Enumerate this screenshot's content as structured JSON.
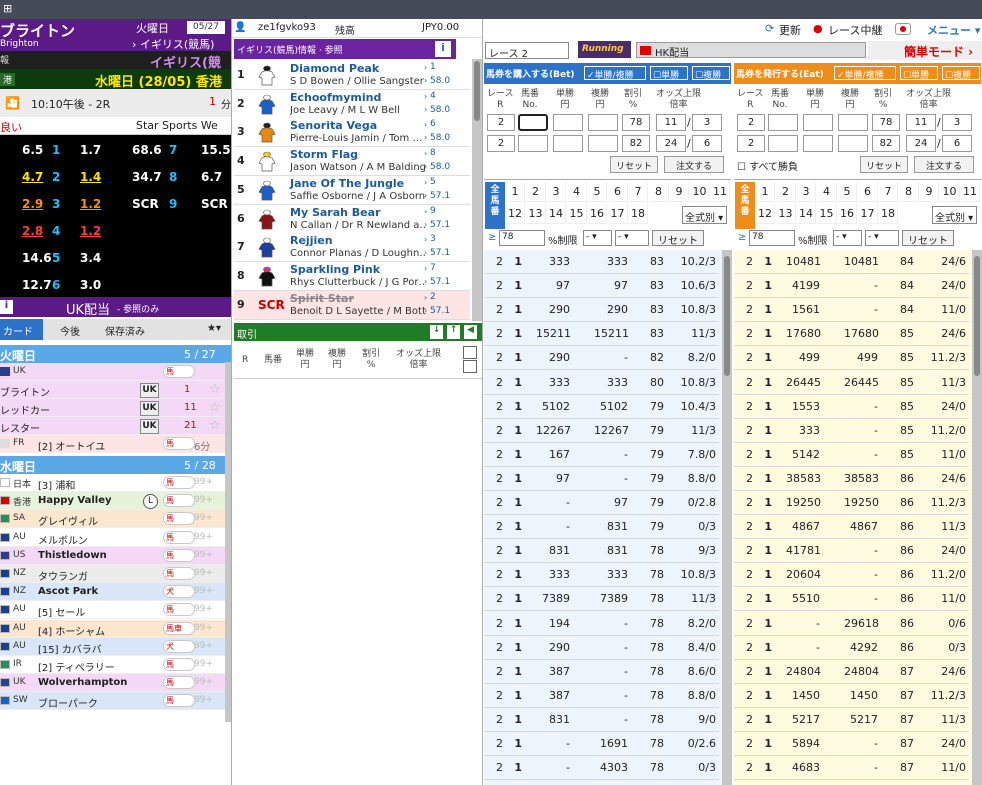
{
  "window": {
    "glyph": "⊞"
  },
  "left": {
    "venue": "ブライトン",
    "venue_en": "Brighton",
    "day_label": "火曜日",
    "date": "05/27",
    "country": "› イギリス(競馬)",
    "info_label": "報",
    "country_name": "イギリス(競馬",
    "local_label": "港",
    "local_date": "水曜日 (28/05) 香港",
    "race_time": "10:10午後 - 2R",
    "race_count": "1",
    "race_unit": "分",
    "going": "良い",
    "tv": "Star Sports We",
    "odds": [
      {
        "a": "6.5",
        "b": "1",
        "c": "1.7",
        "d": "68.6",
        "e": "7",
        "f": "15.5",
        "ca": "wht",
        "cc": "wht",
        "cd": "wht",
        "cf": "wht"
      },
      {
        "a": "4.7",
        "b": "2",
        "c": "1.4",
        "d": "34.7",
        "e": "8",
        "f": "6.7",
        "ca": "yel",
        "cc": "yel",
        "cd": "wht",
        "cf": "wht"
      },
      {
        "a": "2.9",
        "b": "3",
        "c": "1.2",
        "d": "SCR",
        "e": "9",
        "f": "SCR",
        "ca": "org",
        "cc": "org",
        "cd": "wht",
        "cf": "wht"
      },
      {
        "a": "2.8",
        "b": "4",
        "c": "1.2",
        "d": "",
        "e": "",
        "f": "",
        "ca": "red",
        "cc": "red",
        "cd": "wht",
        "cf": "wht"
      },
      {
        "a": "14.6",
        "b": "5",
        "c": "3.4",
        "d": "",
        "e": "",
        "f": "",
        "ca": "wht",
        "cc": "wht",
        "cd": "wht",
        "cf": "wht"
      },
      {
        "a": "12.7",
        "b": "6",
        "c": "3.0",
        "d": "",
        "e": "",
        "f": "",
        "ca": "wht",
        "cc": "wht",
        "cd": "wht",
        "cf": "wht"
      }
    ],
    "uk_payout": "UK配当",
    "uk_ref": "- 参照のみ",
    "tabs": {
      "card": "カード",
      "later": "今後",
      "saved": "保存済み",
      "star": "★▾"
    },
    "tuesday": {
      "label": "火曜日",
      "count": "5 / 27"
    },
    "wednesday": {
      "label": "水曜日",
      "count": "5 / 28"
    },
    "tue_rows": [
      {
        "cc": "UK",
        "name": "",
        "type": "馬",
        "badge": "",
        "num": "",
        "star": ""
      },
      {
        "cc": "",
        "name": "ブライトン",
        "type": "",
        "badge": "UK",
        "num": "1",
        "star": "☆"
      },
      {
        "cc": "",
        "name": "レッドカー",
        "type": "",
        "badge": "UK",
        "num": "11",
        "star": "☆"
      },
      {
        "cc": "",
        "name": "レスター",
        "type": "",
        "badge": "UK",
        "num": "21",
        "star": "☆"
      },
      {
        "cc": "FR",
        "name": "[2] オートイユ",
        "type": "馬",
        "badge": "",
        "num": "6分",
        "star": ""
      }
    ],
    "wed_rows": [
      {
        "cc": "日本",
        "name": "[3] 浦和",
        "type": "馬",
        "ct": "99+",
        "flag": "jp",
        "bg": "#fff"
      },
      {
        "cc": "香港",
        "name": "Happy Valley",
        "type": "馬",
        "ct": "99+",
        "flag": "hk",
        "bg": "#e6f2d9"
      },
      {
        "cc": "SA",
        "name": "グレイヴィル",
        "type": "馬",
        "ct": "99+",
        "flag": "sa",
        "bg": "#fbe7cf"
      },
      {
        "cc": "AU",
        "name": "メルボルン",
        "type": "馬",
        "ct": "99+",
        "flag": "au",
        "bg": "#fff"
      },
      {
        "cc": "US",
        "name": "Thistledown",
        "type": "馬",
        "ct": "99+",
        "flag": "us",
        "bg": "#f3d9f6"
      },
      {
        "cc": "NZ",
        "name": "タウランガ",
        "type": "馬",
        "ct": "99+",
        "flag": "nz",
        "bg": "#ececec"
      },
      {
        "cc": "NZ",
        "name": "Ascot Park",
        "type": "犬",
        "ct": "99+",
        "flag": "nz",
        "bg": "#d9e6f8"
      },
      {
        "cc": "AU",
        "name": "[5] セール",
        "type": "馬",
        "ct": "99+",
        "flag": "au",
        "bg": "#fff"
      },
      {
        "cc": "AU",
        "name": "[4] ホーシャム",
        "type": "馬車",
        "ct": "99+",
        "flag": "au",
        "bg": "#fbe7cf"
      },
      {
        "cc": "AU",
        "name": "[15] カバラバ",
        "type": "犬",
        "ct": "99+",
        "flag": "au",
        "bg": "#d9e6f8"
      },
      {
        "cc": "IR",
        "name": "[2] ティペラリー",
        "type": "馬",
        "ct": "99+",
        "flag": "ir",
        "bg": "#fff"
      },
      {
        "cc": "UK",
        "name": "Wolverhampton",
        "type": "馬",
        "ct": "99+",
        "flag": "uk",
        "bg": "#f3d9f6"
      },
      {
        "cc": "SW",
        "name": "ブローパーク",
        "type": "馬",
        "ct": "99+",
        "flag": "sw",
        "bg": "#d9e6f8"
      }
    ]
  },
  "middle": {
    "user": "ze1fgvko93",
    "balance_label": "残高",
    "balance": "JPY0.00",
    "header": "イギリス(競馬)情報 · 参照",
    "info_icon": "i",
    "horses": [
      {
        "no": "1",
        "name": "Diamond Peak",
        "jockey": "S D Bowen / Ollie Sangster",
        "cn": "1",
        "wt": "58.0",
        "silk": "#ffffff",
        "cap": "#1a1a1a",
        "scr": false
      },
      {
        "no": "2",
        "name": "Echoofmymind",
        "jockey": "Joe Leavy / M L W Bell",
        "cn": "4",
        "wt": "58.0",
        "silk": "#1c5fc8",
        "cap": "#ffffff",
        "scr": false
      },
      {
        "no": "3",
        "name": "Senorita Vega",
        "jockey": "Pierre-Louis Jamin / Tom …",
        "cn": "6",
        "wt": "58.0",
        "silk": "#e58a10",
        "cap": "#222",
        "scr": false
      },
      {
        "no": "4",
        "name": "Storm Flag",
        "jockey": "Jason Watson / A M Balding",
        "cn": "8",
        "wt": "58.0",
        "silk": "#ffffff",
        "cap": "#f2d21c",
        "scr": false
      },
      {
        "no": "5",
        "name": "Jane Of The Jungle",
        "jockey": "Saffie Osborne / J A Osborne",
        "cn": "5",
        "wt": "57.1",
        "silk": "#1c5fc8",
        "cap": "#ffffff",
        "scr": false
      },
      {
        "no": "6",
        "name": "My Sarah Bear",
        "jockey": "N Callan / Dr R Newland a…",
        "cn": "9",
        "wt": "57.1",
        "silk": "#8a1414",
        "cap": "#ffffff",
        "scr": false
      },
      {
        "no": "7",
        "name": "Rejjien",
        "jockey": "Connor Planas / D Loughn…",
        "cn": "3",
        "wt": "57.1",
        "silk": "#1c3fa0",
        "cap": "#ffffff",
        "scr": false
      },
      {
        "no": "8",
        "name": "Sparkling Pink",
        "jockey": "Rhys Clutterbuck / J G Por…",
        "cn": "7",
        "wt": "57.1",
        "silk": "#111111",
        "cap": "#e62c8a",
        "scr": false
      },
      {
        "no": "9",
        "name": "Spirit Star",
        "jockey": "Benoit D L Sayette / M Botti",
        "cn": "2",
        "wt": "57.1",
        "silk": "",
        "cap": "",
        "scr": true,
        "scr_label": "SCR"
      }
    ],
    "trade": "取引",
    "trade_cols": [
      "R",
      "馬番",
      "単勝\n円",
      "複勝\n円",
      "割引\n%",
      "オッズ上限\n倍率"
    ]
  },
  "right": {
    "refresh": "更新",
    "live": "レース中継",
    "menu": "メニュー ▾",
    "race_select": "レース 2",
    "running": "Running",
    "hk_payout": "HK配当",
    "easy_mode": "簡単モード ›",
    "buy": {
      "title": "馬券を購入する(Bet)",
      "win_place": "単勝/複勝",
      "win": "単勝",
      "place": "複勝",
      "color": "#2c72c9",
      "rowbg": "#eef4fb"
    },
    "sell": {
      "title": "馬券を発行する(Eat)",
      "win_place": "単勝/複勝",
      "win": "単勝",
      "place": "複勝",
      "color": "#f08c18",
      "rowbg": "#fffbe0"
    },
    "grid_headers": [
      "レース\nR",
      "馬番\nNo.",
      "単勝\n円",
      "複勝\n円",
      "割引\n%",
      "オッズ上限\n倍率"
    ],
    "buy_inputs": [
      [
        "2",
        "",
        "",
        "",
        "78",
        "11",
        "3"
      ],
      [
        "2",
        "",
        "",
        "",
        "82",
        "24",
        "6"
      ]
    ],
    "sell_inputs": [
      [
        "2",
        "",
        "",
        "",
        "78",
        "11",
        "3"
      ],
      [
        "2",
        "",
        "",
        "",
        "82",
        "24",
        "6"
      ]
    ],
    "reset": "リセット",
    "order": "注文する",
    "all_win": "すべて勝負",
    "all_horses": "全\n馬\n番",
    "numbers1": [
      "1",
      "2",
      "3",
      "4",
      "5",
      "6",
      "7",
      "8",
      "9",
      "10",
      "11"
    ],
    "numbers2": [
      "12",
      "13",
      "14",
      "15",
      "16",
      "17",
      "18"
    ],
    "all_type": "全式別 ▾",
    "limit_val": "78",
    "limit_label": "%制限",
    "limit_dash": "- ▾",
    "buy_rows": [
      [
        "2",
        "1",
        "333",
        "333",
        "83",
        "10.2/3"
      ],
      [
        "2",
        "1",
        "97",
        "97",
        "83",
        "10.6/3"
      ],
      [
        "2",
        "1",
        "290",
        "290",
        "83",
        "10.8/3"
      ],
      [
        "2",
        "1",
        "15211",
        "15211",
        "83",
        "11/3"
      ],
      [
        "2",
        "1",
        "290",
        "-",
        "82",
        "8.2/0"
      ],
      [
        "2",
        "1",
        "333",
        "333",
        "80",
        "10.8/3"
      ],
      [
        "2",
        "1",
        "5102",
        "5102",
        "79",
        "10.4/3"
      ],
      [
        "2",
        "1",
        "12267",
        "12267",
        "79",
        "11/3"
      ],
      [
        "2",
        "1",
        "167",
        "-",
        "79",
        "7.8/0"
      ],
      [
        "2",
        "1",
        "97",
        "-",
        "79",
        "8.8/0"
      ],
      [
        "2",
        "1",
        "-",
        "97",
        "79",
        "0/2.8"
      ],
      [
        "2",
        "1",
        "-",
        "831",
        "79",
        "0/3"
      ],
      [
        "2",
        "1",
        "831",
        "831",
        "78",
        "9/3"
      ],
      [
        "2",
        "1",
        "333",
        "333",
        "78",
        "10.8/3"
      ],
      [
        "2",
        "1",
        "7389",
        "7389",
        "78",
        "11/3"
      ],
      [
        "2",
        "1",
        "194",
        "-",
        "78",
        "8.2/0"
      ],
      [
        "2",
        "1",
        "290",
        "-",
        "78",
        "8.4/0"
      ],
      [
        "2",
        "1",
        "387",
        "-",
        "78",
        "8.6/0"
      ],
      [
        "2",
        "1",
        "387",
        "-",
        "78",
        "8.8/0"
      ],
      [
        "2",
        "1",
        "831",
        "-",
        "78",
        "9/0"
      ],
      [
        "2",
        "1",
        "-",
        "1691",
        "78",
        "0/2.6"
      ],
      [
        "2",
        "1",
        "-",
        "4303",
        "78",
        "0/3"
      ]
    ],
    "sell_rows": [
      [
        "2",
        "1",
        "10481",
        "10481",
        "84",
        "24/6"
      ],
      [
        "2",
        "1",
        "4199",
        "-",
        "84",
        "24/0"
      ],
      [
        "2",
        "1",
        "1561",
        "-",
        "84",
        "11/0"
      ],
      [
        "2",
        "1",
        "17680",
        "17680",
        "85",
        "24/6"
      ],
      [
        "2",
        "1",
        "499",
        "499",
        "85",
        "11.2/3"
      ],
      [
        "2",
        "1",
        "26445",
        "26445",
        "85",
        "11/3"
      ],
      [
        "2",
        "1",
        "1553",
        "-",
        "85",
        "24/0"
      ],
      [
        "2",
        "1",
        "333",
        "-",
        "85",
        "11.2/0"
      ],
      [
        "2",
        "1",
        "5142",
        "-",
        "85",
        "11/0"
      ],
      [
        "2",
        "1",
        "38583",
        "38583",
        "86",
        "24/6"
      ],
      [
        "2",
        "1",
        "19250",
        "19250",
        "86",
        "11.2/3"
      ],
      [
        "2",
        "1",
        "4867",
        "4867",
        "86",
        "11/3"
      ],
      [
        "2",
        "1",
        "41781",
        "-",
        "86",
        "24/0"
      ],
      [
        "2",
        "1",
        "20604",
        "-",
        "86",
        "11.2/0"
      ],
      [
        "2",
        "1",
        "5510",
        "-",
        "86",
        "11/0"
      ],
      [
        "2",
        "1",
        "-",
        "29618",
        "86",
        "0/6"
      ],
      [
        "2",
        "1",
        "-",
        "4292",
        "86",
        "0/3"
      ],
      [
        "2",
        "1",
        "24804",
        "24804",
        "87",
        "24/6"
      ],
      [
        "2",
        "1",
        "1450",
        "1450",
        "87",
        "11.2/3"
      ],
      [
        "2",
        "1",
        "5217",
        "5217",
        "87",
        "11/3"
      ],
      [
        "2",
        "1",
        "5894",
        "-",
        "87",
        "24/0"
      ],
      [
        "2",
        "1",
        "4683",
        "-",
        "87",
        "11/0"
      ]
    ]
  }
}
